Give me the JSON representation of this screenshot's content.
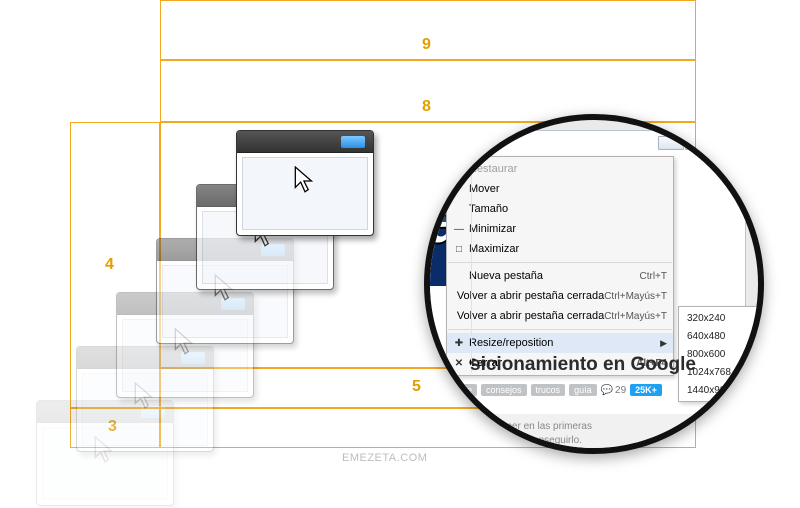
{
  "layout_boxes": {
    "labels": {
      "top1": "9",
      "top2": "8",
      "left": "4",
      "bottom_left": "3",
      "bottom_mid": "5"
    }
  },
  "watermark": "EMEZETA.COM",
  "titlebar_buttons": [
    "minimize",
    "maximize",
    "close"
  ],
  "context_menu": {
    "groups": [
      [
        {
          "icon": "",
          "label": "Restaurar",
          "shortcut": "",
          "disabled": true
        },
        {
          "icon": "",
          "label": "Mover",
          "shortcut": ""
        },
        {
          "icon": "",
          "label": "Tamaño",
          "shortcut": ""
        },
        {
          "icon": "—",
          "label": "Minimizar",
          "shortcut": ""
        },
        {
          "icon": "□",
          "label": "Maximizar",
          "shortcut": ""
        }
      ],
      [
        {
          "icon": "",
          "label": "Nueva pestaña",
          "shortcut": "Ctrl+T"
        },
        {
          "icon": "",
          "label": "Volver a abrir pestaña cerrada",
          "shortcut": "Ctrl+Mayús+T"
        },
        {
          "icon": "",
          "label": "Volver a abrir pestaña cerrada",
          "shortcut": "Ctrl+Mayús+T"
        }
      ],
      [
        {
          "icon": "✚",
          "label": "Resize/reposition",
          "shortcut": "",
          "submenu": true,
          "highlight": true
        },
        {
          "icon": "✕",
          "label": "Cerrar",
          "shortcut": "Alt+F4",
          "bold": true
        }
      ]
    ]
  },
  "submenu": {
    "items": [
      "320x240",
      "640x480",
      "800x600",
      "1024x768",
      "1440x900"
    ]
  },
  "page": {
    "logo_fragment": "ab",
    "headline": "sicionamiento en Google",
    "tags": [
      "le",
      "consejos",
      "trucos",
      "guía"
    ],
    "comments": "29",
    "badge": "25K+",
    "paragraph_l1": "es aparecer en las primeras",
    "paragraph_l2": "rácticas para conseguirlo."
  }
}
